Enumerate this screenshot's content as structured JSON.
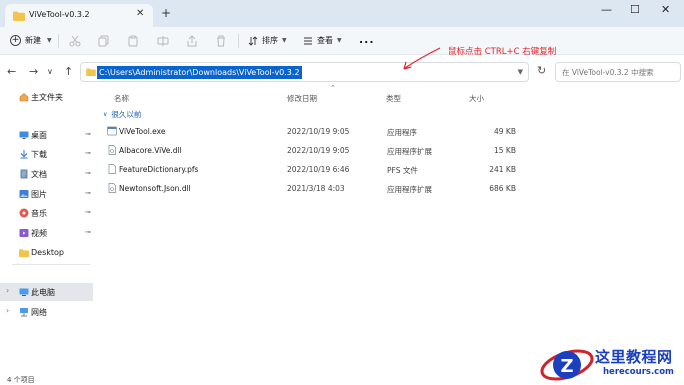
{
  "window": {
    "tab_title": "ViVeTool-v0.3.2",
    "tab_close": "✕",
    "new_tab": "+",
    "minimize": "—",
    "maximize": "☐",
    "close": "✕"
  },
  "toolbar": {
    "new_label": "新建",
    "sort_label": "排序",
    "view_label": "查看",
    "more_label": "..."
  },
  "address": {
    "path": "C:\\Users\\Administrator\\Downloads\\ViVeTool-v0.3.2",
    "search_placeholder": "在 ViVeTool-v0.3.2 中搜索"
  },
  "annotation": {
    "text": "鼠标点击 CTRL+C  右键复制",
    "color": "#e0252a"
  },
  "sidebar": {
    "items": [
      {
        "label": "主文件夹",
        "icon": "home-icon"
      },
      {
        "label": "桌面",
        "icon": "desktop-icon",
        "pinned": true
      },
      {
        "label": "下载",
        "icon": "download-icon",
        "pinned": true
      },
      {
        "label": "文档",
        "icon": "documents-icon",
        "pinned": true
      },
      {
        "label": "图片",
        "icon": "pictures-icon",
        "pinned": true
      },
      {
        "label": "音乐",
        "icon": "music-icon",
        "pinned": true
      },
      {
        "label": "视频",
        "icon": "videos-icon",
        "pinned": true
      },
      {
        "label": "Desktop",
        "icon": "folder-icon"
      },
      {
        "label": "此电脑",
        "icon": "this-pc-icon",
        "selected": true
      },
      {
        "label": "网络",
        "icon": "network-icon"
      }
    ]
  },
  "columns": {
    "name": "名称",
    "date": "修改日期",
    "type": "类型",
    "size": "大小"
  },
  "group": {
    "label": "很久以前"
  },
  "files": [
    {
      "name": "ViVeTool.exe",
      "date": "2022/10/19 9:05",
      "type": "应用程序",
      "size": "49 KB",
      "icon": "exe-icon"
    },
    {
      "name": "Albacore.ViVe.dll",
      "date": "2022/10/19 9:05",
      "type": "应用程序扩展",
      "size": "15 KB",
      "icon": "dll-icon"
    },
    {
      "name": "FeatureDictionary.pfs",
      "date": "2022/10/19 6:46",
      "type": "PFS 文件",
      "size": "241 KB",
      "icon": "file-icon"
    },
    {
      "name": "Newtonsoft.Json.dll",
      "date": "2021/3/18 4:03",
      "type": "应用程序扩展",
      "size": "686 KB",
      "icon": "dll-icon"
    }
  ],
  "status": {
    "item_count": "4 个项目"
  },
  "watermark": {
    "logo_letter": "Z",
    "title": "这里教程网",
    "site": "herecours.com"
  },
  "colors": {
    "accent": "#0a64d0",
    "folder": "#f2c44b",
    "watermark": "#1a3fbf"
  }
}
